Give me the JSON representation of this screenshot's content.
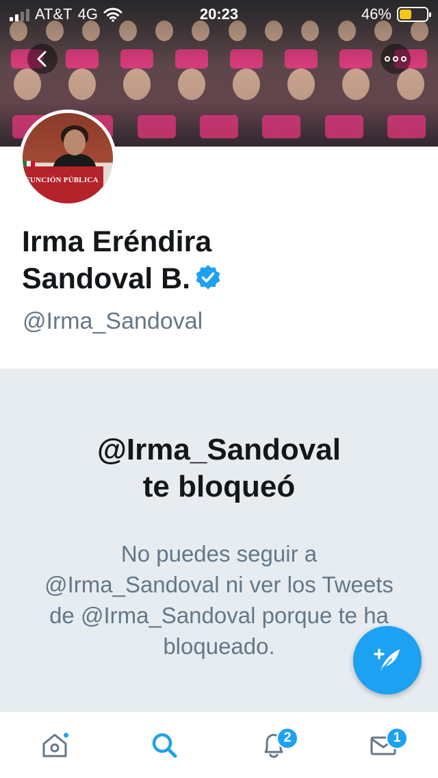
{
  "status_bar": {
    "carrier": "AT&T",
    "network": "4G",
    "time": "20:23",
    "battery_percent": "46%",
    "battery_level": 0.46,
    "battery_color": "#f5c518"
  },
  "header": {
    "back_icon": "chevron-left-icon",
    "more_icon": "more-horizontal-icon"
  },
  "avatar": {
    "podium_text": "FUNCIÓN PÚBLICA"
  },
  "profile": {
    "name_line1": "Irma Eréndira",
    "name_line2": "Sandoval B.",
    "verified": true,
    "handle": "@Irma_Sandoval"
  },
  "blocked": {
    "title_line1": "@Irma_Sandoval",
    "title_line2": "te bloqueó",
    "description": "No puedes seguir a @Irma_Sandoval ni ver los Tweets de @Irma_Sandoval porque te ha bloqueado."
  },
  "fab": {
    "icon": "compose-tweet-icon"
  },
  "tab_bar": {
    "items": [
      {
        "name": "home",
        "icon": "home-icon",
        "active": false,
        "has_dot": true
      },
      {
        "name": "search",
        "icon": "search-icon",
        "active": true
      },
      {
        "name": "notifications",
        "icon": "bell-icon",
        "active": false,
        "badge": "2"
      },
      {
        "name": "messages",
        "icon": "mail-icon",
        "active": false,
        "badge": "1"
      }
    ]
  },
  "colors": {
    "accent": "#1da1f2",
    "muted_text": "#657786",
    "blocked_bg": "#e6ecf0"
  }
}
